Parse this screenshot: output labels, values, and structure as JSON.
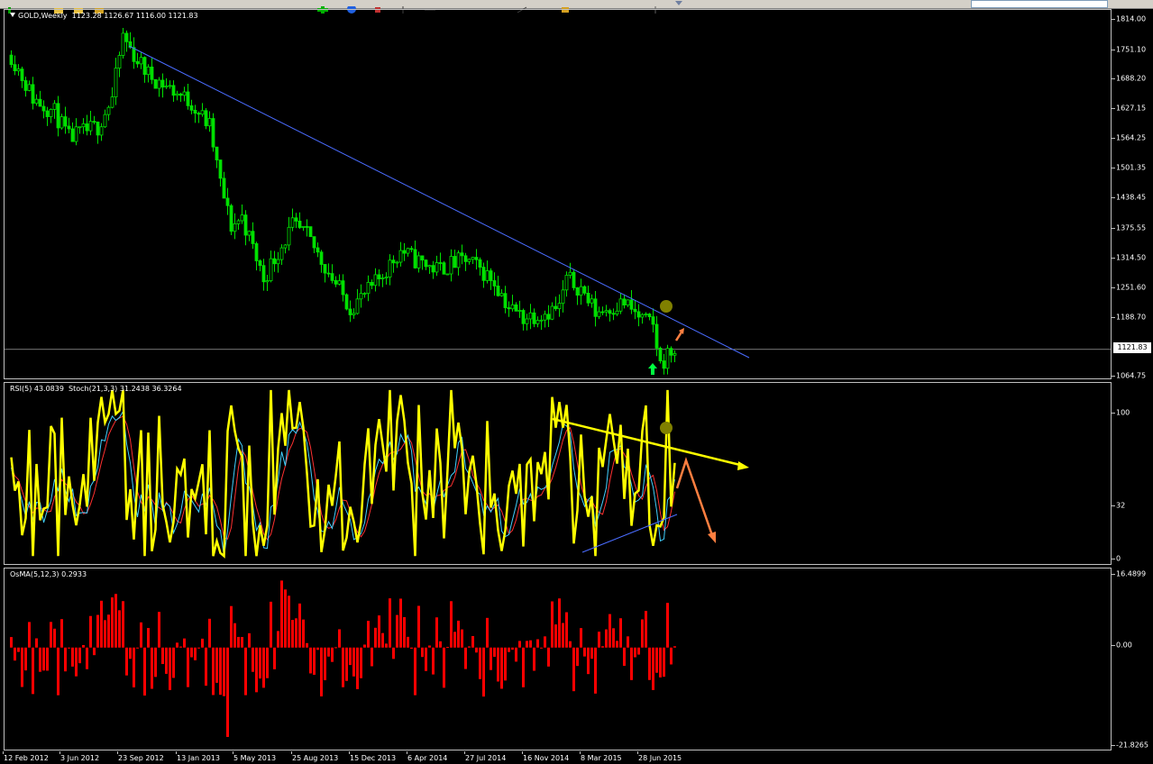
{
  "colors": {
    "background": "#000000",
    "candle": "#00e000",
    "trendline": "#4a6cff",
    "rsi": "#ffff00",
    "stoch_main": "#40d0ff",
    "stoch_signal": "#ff3030",
    "osma": "#ff0000",
    "arrow_orange": "#ff7f40",
    "marker_dot": "#808000",
    "up_arrow": "#00ff40",
    "price_line": "#c0c0c0"
  },
  "icons": [
    "new-chart-icon",
    "open-icon",
    "save-icon",
    "print-icon",
    "add-icon",
    "globe-icon",
    "cursor-icon",
    "crosshair-icon",
    "hline-icon",
    "trendline-icon",
    "text-icon",
    "arrow-icon"
  ],
  "main_pane": {
    "title": "GOLD,Weekly  1123.28 1126.67 1116.00 1121.83",
    "price_ticks": [
      "1814.00",
      "1751.10",
      "1688.20",
      "1627.15",
      "1564.25",
      "1501.35",
      "1438.45",
      "1375.55",
      "1314.50",
      "1251.60",
      "1188.70",
      "1121.83",
      "1064.75"
    ],
    "current_price": "1121.83"
  },
  "rsi_pane": {
    "title": "RSI(5) 43.0839  Stoch(21,3,3) 31.2438 36.3264",
    "ticks": [
      "100",
      "32",
      "0"
    ]
  },
  "osma_pane": {
    "title": "OsMA(5,12,3) 0.2933",
    "ticks": [
      "16.4899",
      "0.00",
      "-21.8265"
    ]
  },
  "date_axis": {
    "labels": [
      "12 Feb 2012",
      "3 Jun 2012",
      "23 Sep 2012",
      "13 Jan 2013",
      "5 May 2013",
      "25 Aug 2013",
      "15 Dec 2013",
      "6 Apr 2014",
      "27 Jul 2014",
      "16 Nov 2014",
      "8 Mar 2015",
      "28 Jun 2015"
    ]
  },
  "chart_data": [
    {
      "type": "candlestick",
      "title": "GOLD,Weekly",
      "ylim": [
        1064.75,
        1814.0
      ],
      "x": [
        "12 Feb 2012",
        "3 Jun 2012",
        "23 Sep 2012",
        "13 Jan 2013",
        "5 May 2013",
        "25 Aug 2013",
        "15 Dec 2013",
        "6 Apr 2014",
        "27 Jul 2014",
        "16 Nov 2014",
        "8 Mar 2015",
        "28 Jun 2015"
      ],
      "close": [
        1730,
        1575,
        1780,
        1670,
        1390,
        1400,
        1230,
        1300,
        1310,
        1200,
        1200,
        1122
      ],
      "last": {
        "open": 1123.28,
        "high": 1126.67,
        "low": 1116.0,
        "close": 1121.83
      }
    },
    {
      "type": "line",
      "title": "RSI(5) / Stoch(21,3,3)",
      "ylim": [
        0,
        100
      ],
      "series": [
        {
          "name": "RSI(5)",
          "last": 43.0839
        },
        {
          "name": "Stoch main",
          "last": 31.2438
        },
        {
          "name": "Stoch signal",
          "last": 36.3264
        }
      ]
    },
    {
      "type": "bar",
      "title": "OsMA(5,12,3)",
      "ylim": [
        -21.8265,
        16.4899
      ],
      "last": 0.2933
    }
  ]
}
